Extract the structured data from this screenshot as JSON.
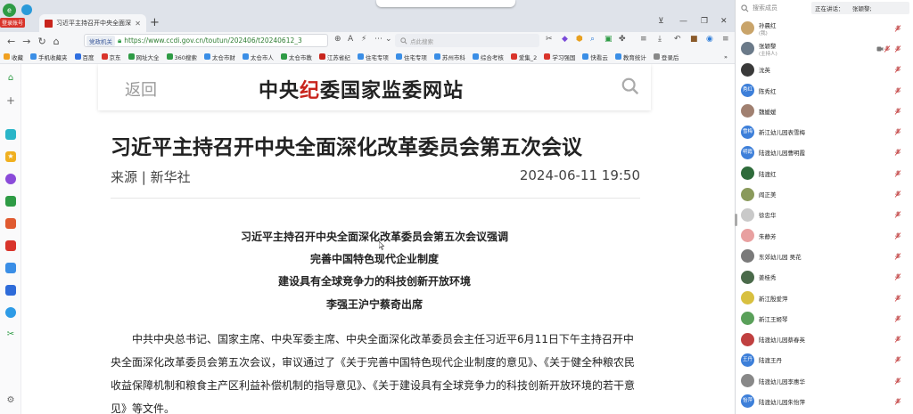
{
  "browser": {
    "login_badge": "登录账号",
    "tab_title": "习近平主持召开中央全面深化改",
    "tab_close": "✕",
    "new_tab": "+",
    "address": {
      "tag": "党政机关",
      "url": "https://www.ccdi.gov.cn/toutun/202406/t20240612_3"
    },
    "search_placeholder": "点此搜索",
    "bookmarks": [
      {
        "label": "收藏",
        "color": "#f0a020"
      },
      {
        "label": "手机收藏夹",
        "color": "#3a8ee6"
      },
      {
        "label": "百度",
        "color": "#2f6fe0"
      },
      {
        "label": "京东",
        "color": "#d9342b"
      },
      {
        "label": "网址大全",
        "color": "#2e9b45"
      },
      {
        "label": "360搜索",
        "color": "#2e9b45"
      },
      {
        "label": "太仓市财",
        "color": "#3a8ee6"
      },
      {
        "label": "太仓市人",
        "color": "#3a8ee6"
      },
      {
        "label": "太仓市教",
        "color": "#2e9b45"
      },
      {
        "label": "江苏省纪",
        "color": "#c8241c"
      },
      {
        "label": "住宅专项",
        "color": "#3a8ee6"
      },
      {
        "label": "住宅专项",
        "color": "#3a8ee6"
      },
      {
        "label": "苏州市科",
        "color": "#3a8ee6"
      },
      {
        "label": "综合考核",
        "color": "#3a8ee6"
      },
      {
        "label": "爱集_2",
        "color": "#d9342b"
      },
      {
        "label": "学习强国",
        "color": "#d9342b"
      },
      {
        "label": "快看云",
        "color": "#3a8ee6"
      },
      {
        "label": "教育统计",
        "color": "#3a8ee6"
      },
      {
        "label": "登录后",
        "color": "#888888"
      }
    ]
  },
  "site": {
    "back_label": "返回",
    "name_part1": "中央",
    "name_red": "纪",
    "name_part2": "委国家监委网站"
  },
  "article": {
    "title": "习近平主持召开中央全面深化改革委员会第五次会议",
    "source": "来源 | 新华社",
    "date": "2024-06-11 19:50",
    "subheads": [
      "习近平主持召开中央全面深化改革委员会第五次会议强调",
      "完善中国特色现代企业制度",
      "建设具有全球竞争力的科技创新开放环境",
      "李强王沪宁蔡奇出席"
    ],
    "paragraph": "中共中央总书记、国家主席、中央军委主席、中央全面深化改革委员会主任习近平6月11日下午主持召开中央全面深化改革委员会第五次会议，审议通过了《关于完善中国特色现代企业制度的意见》、《关于健全种粮农民收益保障机制和粮食主产区利益补偿机制的指导意见》、《关于建设具有全球竞争力的科技创新开放环境的若干意见》等文件。"
  },
  "panel": {
    "search_placeholder": "搜索成员",
    "speaking_label": "正在讲话：",
    "speaking_name": "张颖黎;",
    "participants": [
      {
        "name": "孙晨红",
        "sub": "(我)",
        "avatar_text": "",
        "color": "#c9a46a",
        "cam": false
      },
      {
        "name": "张颖黎",
        "sub": "(主持人)",
        "avatar_text": "",
        "color": "#6b7a89",
        "cam": true
      },
      {
        "name": "沈英",
        "sub": "",
        "avatar_text": "",
        "color": "#3a3a3a",
        "cam": false
      },
      {
        "name": "陈秀红",
        "sub": "",
        "avatar_text": "秀红",
        "color": "#3d7fd9",
        "cam": false
      },
      {
        "name": "魏媛媛",
        "sub": "",
        "avatar_text": "",
        "color": "#a08070",
        "cam": false
      },
      {
        "name": "新江幼儿园表雪梅",
        "sub": "",
        "avatar_text": "雪梅",
        "color": "#3d7fd9",
        "cam": false
      },
      {
        "name": "陆渡幼儿园曹明霞",
        "sub": "",
        "avatar_text": "明霞",
        "color": "#3d7fd9",
        "cam": false
      },
      {
        "name": "陆渡红",
        "sub": "",
        "avatar_text": "",
        "color": "#2e6b3a",
        "cam": false
      },
      {
        "name": "阎正美",
        "sub": "",
        "avatar_text": "",
        "color": "#8a9a5b",
        "cam": false
      },
      {
        "name": "徐忠华",
        "sub": "",
        "avatar_text": "",
        "color": "#c9c9c9",
        "cam": false
      },
      {
        "name": "朱静芳",
        "sub": "",
        "avatar_text": "",
        "color": "#e8a0a0",
        "cam": false
      },
      {
        "name": "东郊幼儿园 吴花",
        "sub": "",
        "avatar_text": "",
        "color": "#7a7a7a",
        "cam": false
      },
      {
        "name": "姜桂秀",
        "sub": "",
        "avatar_text": "",
        "color": "#4a6a4a",
        "cam": false
      },
      {
        "name": "新江殷爱萍",
        "sub": "",
        "avatar_text": "",
        "color": "#d8c040",
        "cam": false
      },
      {
        "name": "新江王姬琴",
        "sub": "",
        "avatar_text": "",
        "color": "#5aa05a",
        "cam": false
      },
      {
        "name": "陆渡幼儿园蔡春英",
        "sub": "",
        "avatar_text": "",
        "color": "#c04040",
        "cam": false
      },
      {
        "name": "陆渡王丹",
        "sub": "",
        "avatar_text": "王丹",
        "color": "#3d7fd9",
        "cam": false
      },
      {
        "name": "陆渡幼儿园李惠华",
        "sub": "",
        "avatar_text": "",
        "color": "#888888",
        "cam": false
      },
      {
        "name": "陆渡幼儿园朱怡萍",
        "sub": "",
        "avatar_text": "怡萍",
        "color": "#3d7fd9",
        "cam": false
      }
    ]
  }
}
